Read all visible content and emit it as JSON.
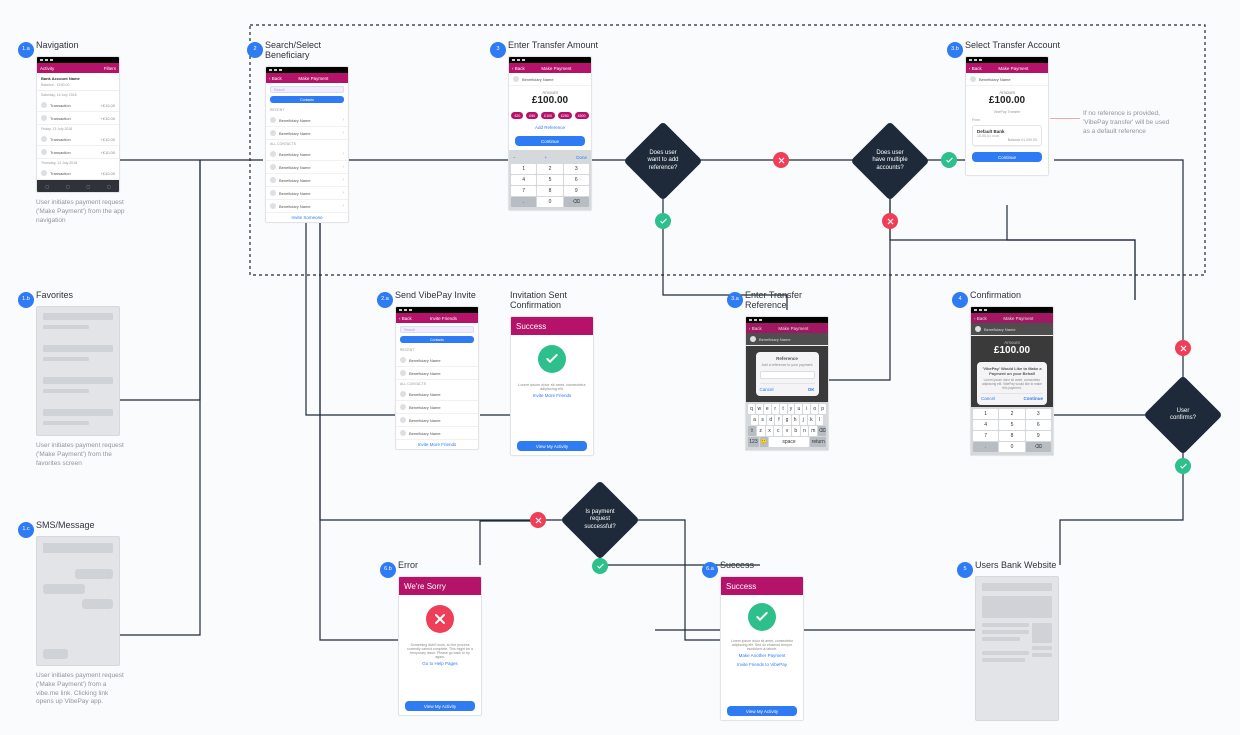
{
  "colors": {
    "accent_blue": "#2e7bf4",
    "navy": "#1e2a3a",
    "magenta": "#b5126a",
    "green": "#2ec08c",
    "red": "#ef3e58"
  },
  "screens": {
    "nav": {
      "badge": "1.a",
      "title": "Navigation",
      "subtitle": "User initiates payment request ('Make Payment') from the app navigation",
      "header_left": "Activity",
      "header_right": "Filters",
      "account_name": "Bank Account Name",
      "balance": "Balance - £190.00",
      "groups": [
        {
          "date": "Saturday, 14 July 2018",
          "items": [
            {
              "label": "Transaction",
              "amount": "+£10.00"
            },
            {
              "label": "Transaction",
              "amount": "+£10.00"
            }
          ]
        },
        {
          "date": "Friday, 13 July 2018",
          "items": [
            {
              "label": "Transaction",
              "amount": "+£10.00"
            },
            {
              "label": "Transaction",
              "amount": "+£10.00"
            }
          ]
        },
        {
          "date": "Thursday, 12 July 2018",
          "items": [
            {
              "label": "Transaction",
              "amount": "+£10.00"
            }
          ]
        }
      ],
      "tabs": [
        "Activity",
        "Make Payment",
        "Request Payment",
        "Profile"
      ]
    },
    "search": {
      "badge": "2",
      "title": "Search/Select\nBeneficiary",
      "nav_back": "‹ Back",
      "nav_title": "Make Payment",
      "search_placeholder": "Search",
      "segmented": "Contacts",
      "recent_label": "RECENT",
      "contacts_label": "ALL CONTACTS",
      "items": [
        "Beneficiary Name",
        "Beneficiary Name",
        "Beneficiary Name",
        "Beneficiary Name",
        "Beneficiary Name",
        "Beneficiary Name",
        "Beneficiary Name"
      ],
      "footer_link": "Invite Someone"
    },
    "amount": {
      "badge": "3",
      "title": "Enter Transfer Amount",
      "nav_back": "‹ Back",
      "nav_title": "Make Payment",
      "payee": "Beneficiary Name",
      "amount_label": "Amount",
      "amount": "£100.00",
      "pills": [
        "£20",
        "£50",
        "£100",
        "£250",
        "£500"
      ],
      "ref_link": "Add Reference",
      "continue": "Continue",
      "numpad": [
        [
          "1",
          "2",
          "3"
        ],
        [
          "4",
          "5",
          "6"
        ],
        [
          "7",
          "8",
          "9"
        ],
        [
          ".",
          "0",
          "⌫"
        ]
      ],
      "numpad_toprow": [
        "–",
        "+",
        "Done"
      ]
    },
    "select_acct": {
      "badge": "3.b",
      "title": "Select Transfer Account",
      "nav_back": "‹ Back",
      "nav_title": "Make Payment",
      "payee": "Beneficiary Name",
      "amount_label": "Amount",
      "amount": "£100.00",
      "ref_label": "VibePay Transfer",
      "from_label": "From",
      "account_name": "Default Bank",
      "account_sort": "10-00-01  ••••••",
      "account_balance": "Balance  £1,000.00",
      "continue": "Continue",
      "annotation": "If no reference is provided, 'VibePay transfer' will be used as a default reference"
    },
    "favorites": {
      "badge": "1.b",
      "title": "Favorites",
      "subtitle": "User initiates payment request ('Make Payment') from the favorites screen"
    },
    "invite": {
      "badge": "2.a",
      "title": "Send VibePay Invite",
      "nav_back": "‹ Back",
      "nav_title": "Invite Friends",
      "search_placeholder": "Search",
      "segmented": "Contacts",
      "recent_label": "RECENT",
      "contacts_label": "ALL CONTACTS",
      "items": [
        "Beneficiary Name",
        "Beneficiary Name",
        "Beneficiary Name",
        "Beneficiary Name",
        "Beneficiary Name",
        "Beneficiary Name"
      ],
      "footer_link": "Invite More Friends"
    },
    "invite_conf": {
      "badge": "",
      "title": "Invitation Sent\nConfirmation",
      "hero": "Success",
      "body": "Lorem ipsum dolor sit amet, consectetur adipiscing elit.",
      "link": "Invite More Friends",
      "button": "View My Activity"
    },
    "reference": {
      "badge": "3.a",
      "title": "Enter Transfer\nReference",
      "nav_back": "‹ Back",
      "nav_title": "Make Payment",
      "payee": "Beneficiary Name",
      "sheet_title": "Reference",
      "sheet_sub": "Add a reference to your payment",
      "sheet_cancel": "Cancel",
      "sheet_ok": "OK",
      "keyboard_rows": [
        [
          "q",
          "w",
          "e",
          "r",
          "t",
          "y",
          "u",
          "i",
          "o",
          "p"
        ],
        [
          "a",
          "s",
          "d",
          "f",
          "g",
          "h",
          "j",
          "k",
          "l"
        ],
        [
          "⇧",
          "z",
          "x",
          "c",
          "v",
          "b",
          "n",
          "m",
          "⌫"
        ],
        [
          "123",
          "🙂",
          "space",
          "return"
        ]
      ]
    },
    "confirmation": {
      "badge": "4",
      "title": "Confirmation",
      "nav_back": "‹ Back",
      "nav_title": "Make Payment",
      "payee": "Beneficiary Name",
      "amount_label": "Amount",
      "amount": "£100.00",
      "dialog_title": "'VibePay' Would Like to Make a Payment on your Behalf",
      "dialog_body": "Lorem ipsum dolor sit amet, consectetur adipiscing elit. VibePay would like to make this payment.",
      "dialog_cancel": "Cancel",
      "dialog_ok": "Continue",
      "numpad": [
        [
          "1",
          "2",
          "3"
        ],
        [
          "4",
          "5",
          "6"
        ],
        [
          "7",
          "8",
          "9"
        ],
        [
          ".",
          "0",
          "⌫"
        ]
      ]
    },
    "sms": {
      "badge": "1.c",
      "title": "SMS/Message",
      "subtitle": "User initiates payment request ('Make Payment') from a vibe.me link. Clicking link opens up VibePay app."
    },
    "error": {
      "badge": "6.b",
      "title": "Error",
      "hero": "We're Sorry",
      "body": "Something didn't work, so the process currently cannot complete. This might be a temporary issue. Please go back to try again.",
      "link": "Go to Help Pages",
      "button": "View My Activity"
    },
    "success": {
      "badge": "6.a",
      "title": "Success",
      "hero": "Success",
      "body": "Lorem ipsum dolor sit amet, consectetur adipiscing elit. Sed do eiusmod tempor incididunt ut labore.",
      "link1": "Make Another Payment",
      "link2": "Invite Friends to VibePay",
      "button": "View My Activity"
    },
    "bank": {
      "badge": "5",
      "title": "Users Bank Website"
    }
  },
  "decisions": {
    "d1": "Does user want to add reference?",
    "d2": "Does user have multiple accounts?",
    "d3": "User confirms?",
    "d4": "Is payment request successful?"
  }
}
